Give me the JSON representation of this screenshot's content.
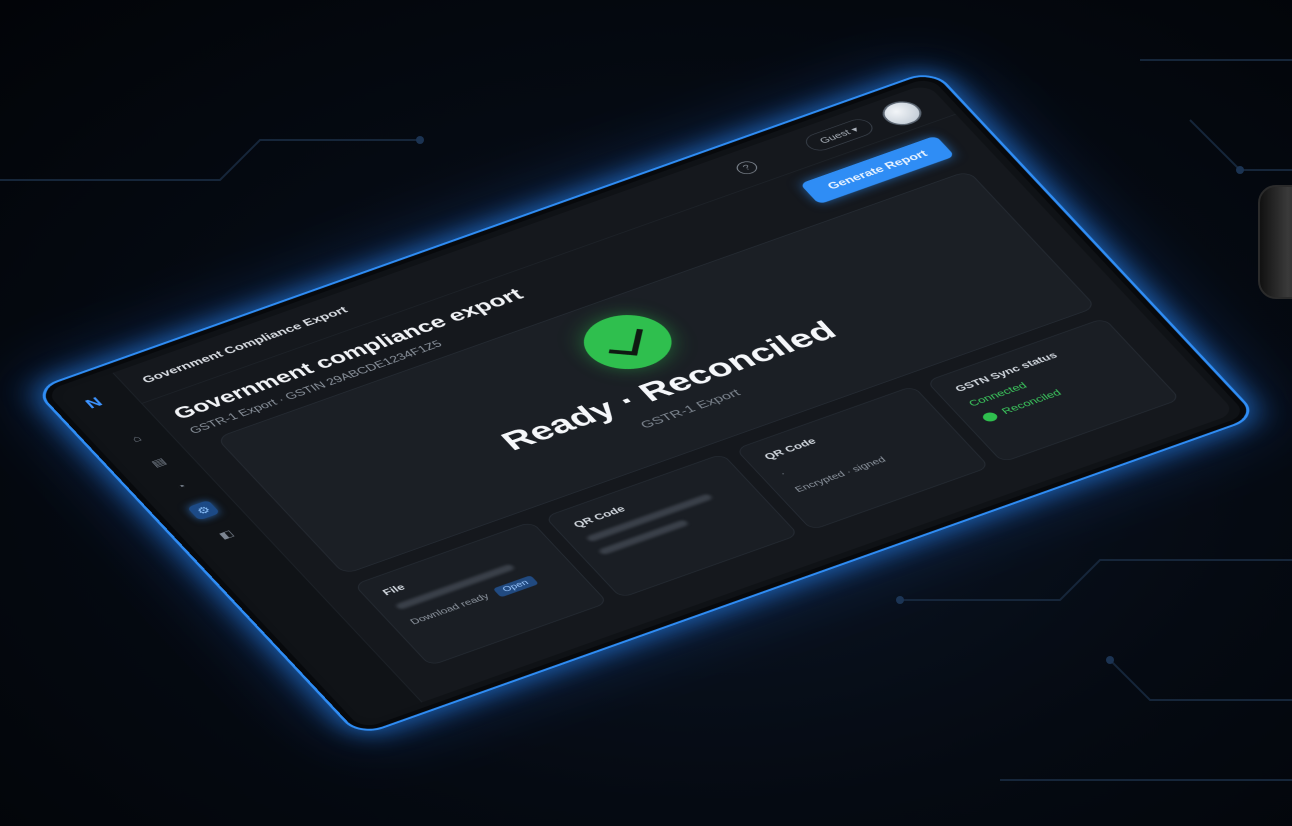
{
  "app": {
    "window_title": "Government Compliance Export",
    "logo_text": "N"
  },
  "header": {
    "help_icon": "help-circle-icon",
    "user_label": "Guest ▾",
    "primary_action": "Generate Report"
  },
  "page": {
    "title": "Government compliance export",
    "subtitle": "GSTR-1 Export · GSTIN 29ABCDE1234F1Z5"
  },
  "nav": {
    "items": [
      {
        "icon": "home-icon",
        "glyph": "⌂"
      },
      {
        "icon": "document-icon",
        "glyph": "▤"
      },
      {
        "icon": "chart-icon",
        "glyph": "◔"
      },
      {
        "icon": "gear-icon",
        "glyph": "⚙"
      },
      {
        "icon": "archive-icon",
        "glyph": "◧"
      }
    ],
    "active_index": 3
  },
  "status": {
    "icon": "check-circle-icon",
    "headline": "Ready · Reconciled",
    "subheadline": "GSTR-1 Export"
  },
  "cards": {
    "file": {
      "label": "File",
      "download_text": "Download ready",
      "link": "Open"
    },
    "qr_code": {
      "label": "QR Code"
    },
    "qr_code_secondary": {
      "label": "QR Code",
      "dot": "·",
      "value": "Encrypted · signed"
    },
    "gstn_sync": {
      "label": "GSTN Sync status",
      "connected": "Connected",
      "reconciled": "Reconciled"
    }
  },
  "colors": {
    "accent": "#2f8df5",
    "success": "#2fbf4e",
    "frame_glow": "#2f8df5",
    "background": "#050a12"
  }
}
